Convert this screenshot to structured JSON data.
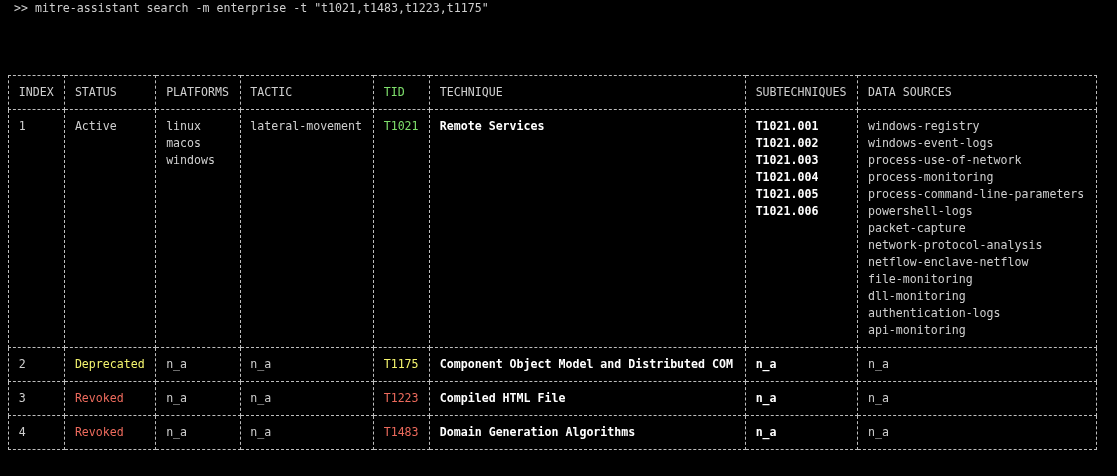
{
  "terminal": {
    "command": ">> mitre-assistant search -m enterprise -t \"t1021,t1483,t1223,t1175\""
  },
  "table": {
    "columns": [
      "INDEX",
      "STATUS",
      "PLATFORMS",
      "TACTIC",
      "TID",
      "TECHNIQUE",
      "SUBTECHNIQUES",
      "DATA SOURCES"
    ],
    "rows": [
      {
        "kind": "active",
        "index": "1",
        "status": "Active",
        "platforms": [
          "linux",
          "macos",
          "windows"
        ],
        "tactic": "lateral-movement",
        "tid": "T1021",
        "technique": "Remote Services",
        "subtechniques": [
          "T1021.001",
          "T1021.002",
          "T1021.003",
          "T1021.004",
          "T1021.005",
          "T1021.006"
        ],
        "data_sources": [
          "windows-registry",
          "windows-event-logs",
          "process-use-of-network",
          "process-monitoring",
          "process-command-line-parameters",
          "powershell-logs",
          "packet-capture",
          "network-protocol-analysis",
          "netflow-enclave-netflow",
          "file-monitoring",
          "dll-monitoring",
          "authentication-logs",
          "api-monitoring"
        ]
      },
      {
        "kind": "deprecated",
        "index": "2",
        "status": "Deprecated",
        "platforms": [
          "n_a"
        ],
        "tactic": "n_a",
        "tid": "T1175",
        "technique": "Component Object Model and Distributed COM",
        "subtechniques": [
          "n_a"
        ],
        "data_sources": [
          "n_a"
        ]
      },
      {
        "kind": "revoked",
        "index": "3",
        "status": "Revoked",
        "platforms": [
          "n_a"
        ],
        "tactic": "n_a",
        "tid": "T1223",
        "technique": "Compiled HTML File",
        "subtechniques": [
          "n_a"
        ],
        "data_sources": [
          "n_a"
        ]
      },
      {
        "kind": "revoked",
        "index": "4",
        "status": "Revoked",
        "platforms": [
          "n_a"
        ],
        "tactic": "n_a",
        "tid": "T1483",
        "technique": "Domain Generation Algorithms",
        "subtechniques": [
          "n_a"
        ],
        "data_sources": [
          "n_a"
        ]
      }
    ]
  }
}
